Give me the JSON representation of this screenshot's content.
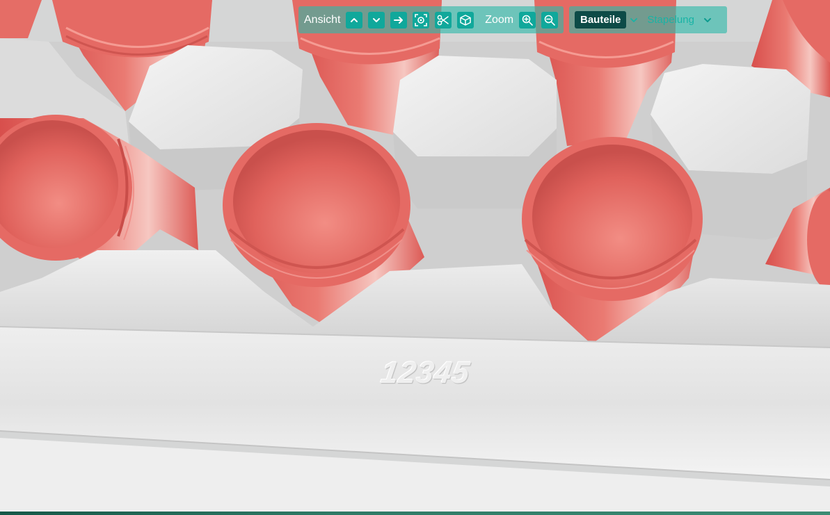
{
  "view": {
    "label": "Ansicht",
    "buttons": [
      "up",
      "down",
      "right",
      "frame",
      "cut",
      "cube"
    ]
  },
  "zoom": {
    "label": "Zoom",
    "buttons": [
      "zoom-in",
      "zoom-out"
    ]
  },
  "parts": {
    "components_label": "Bauteile",
    "stacking_label": "Stapelung"
  },
  "scene": {
    "tray_stamp": "12345",
    "colors": {
      "tray": "#dadada",
      "pot": "#e0625c",
      "toolbar_accent": "#10a89b",
      "active_segment": "#0d4b47"
    }
  }
}
